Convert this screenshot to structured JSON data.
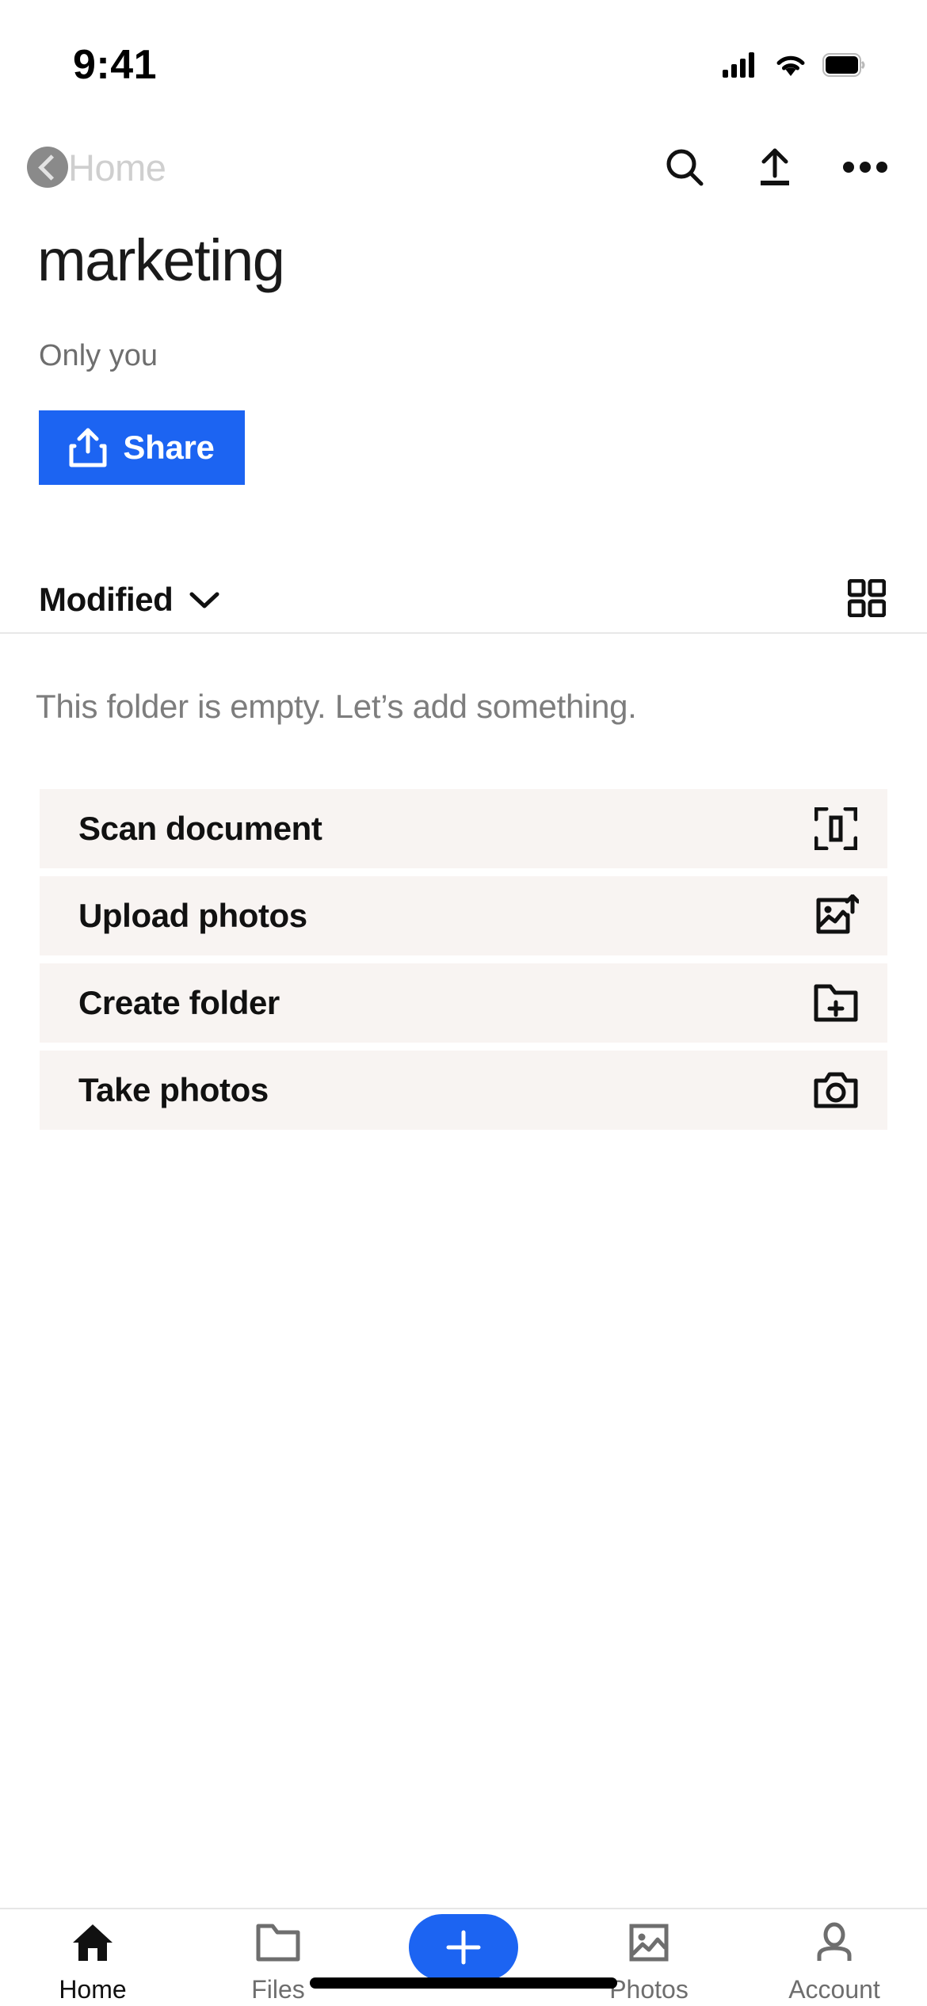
{
  "status_bar": {
    "time": "9:41",
    "cellular_icon": "cellular-signal-icon",
    "wifi_icon": "wifi-icon",
    "battery_icon": "battery-icon"
  },
  "nav": {
    "back_label": "Home",
    "back_icon": "chevron-left-icon",
    "search_icon": "search-icon",
    "upload_icon": "upload-icon",
    "more_icon": "more-horizontal-icon"
  },
  "header": {
    "title": "marketing",
    "subtitle": "Only you",
    "share_label": "Share",
    "share_icon": "share-export-icon"
  },
  "sort": {
    "label": "Modified",
    "chevron_icon": "chevron-down-icon",
    "view_toggle_icon": "grid-view-icon"
  },
  "empty_state": {
    "message": "This folder is empty. Let’s add something."
  },
  "actions": [
    {
      "label": "Scan document",
      "icon": "scan-document-icon"
    },
    {
      "label": "Upload photos",
      "icon": "image-upload-icon"
    },
    {
      "label": "Create folder",
      "icon": "folder-plus-icon"
    },
    {
      "label": "Take photos",
      "icon": "camera-icon"
    }
  ],
  "tabbar": {
    "items": [
      {
        "label": "Home",
        "icon": "home-icon",
        "active": true
      },
      {
        "label": "Files",
        "icon": "folder-icon",
        "active": false
      },
      {
        "label": "Photos",
        "icon": "photos-icon",
        "active": false
      },
      {
        "label": "Account",
        "icon": "account-icon",
        "active": false
      }
    ],
    "fab_icon": "plus-icon"
  },
  "colors": {
    "accent_blue": "#1c64f2",
    "card_background": "#f8f4f2",
    "muted_text": "#6e6e6e",
    "primary_text": "#111111"
  }
}
